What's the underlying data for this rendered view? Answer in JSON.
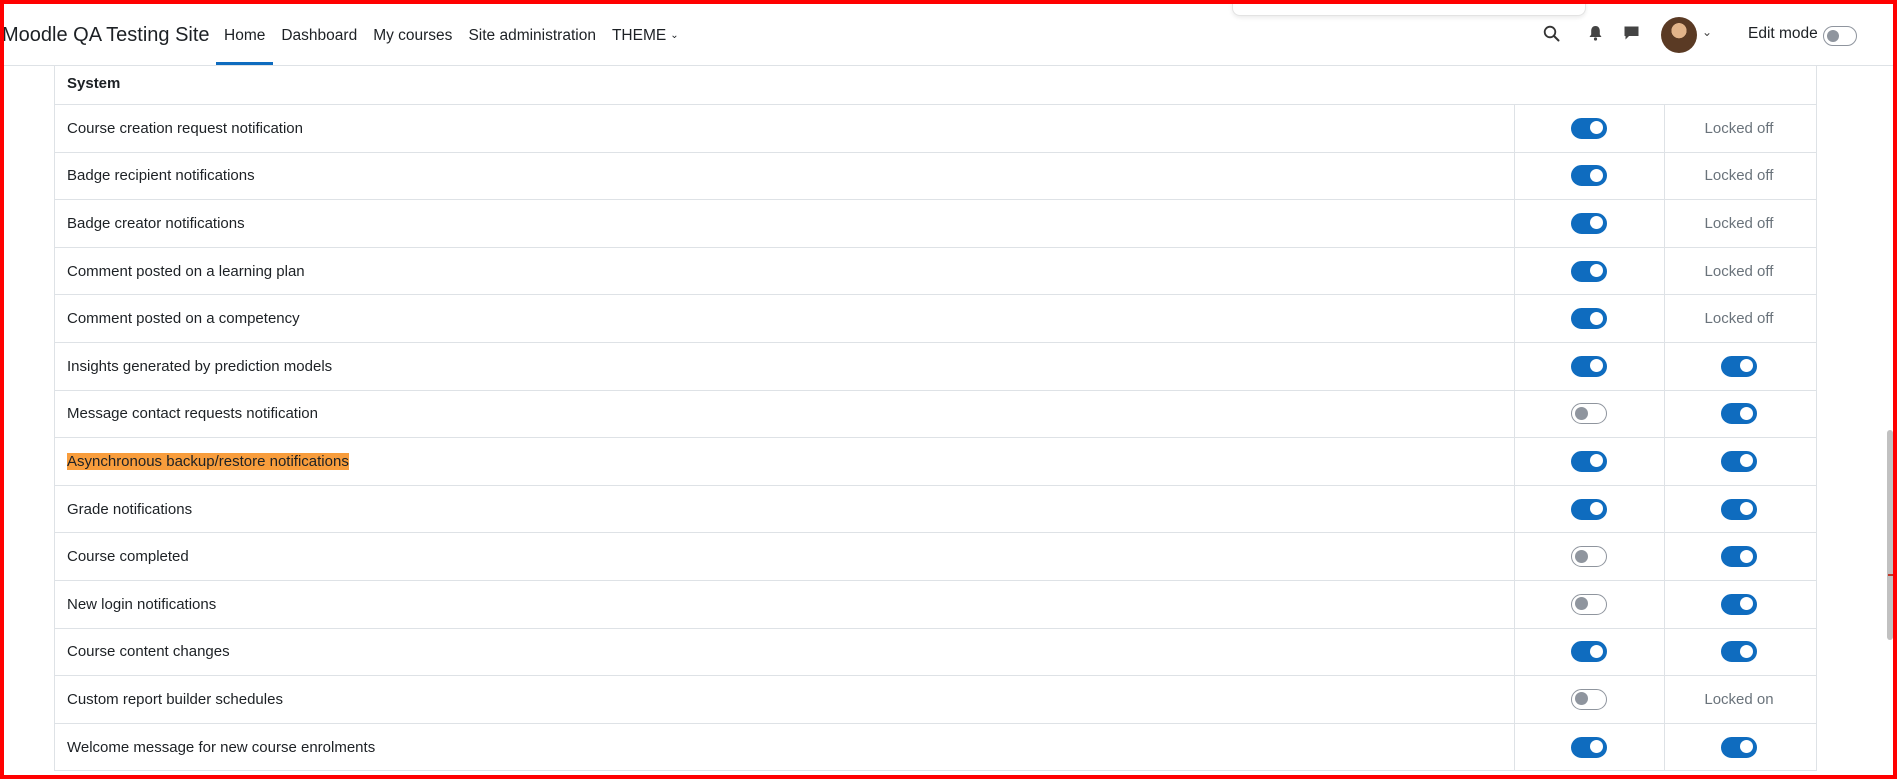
{
  "navbar": {
    "site_name": "Moodle QA Testing Site",
    "items": [
      {
        "label": "Home",
        "active": true
      },
      {
        "label": "Dashboard",
        "active": false
      },
      {
        "label": "My courses",
        "active": false
      },
      {
        "label": "Site administration",
        "active": false
      },
      {
        "label": "THEME",
        "active": false,
        "dropdown": true
      }
    ],
    "icons": [
      "search-icon",
      "bell-icon",
      "chat-icon"
    ],
    "edit_mode_label": "Edit mode",
    "edit_mode_on": false
  },
  "table": {
    "section_header": "System",
    "rows": [
      {
        "name": "Course creation request notification",
        "col_a": "on",
        "col_b": "Locked off"
      },
      {
        "name": "Badge recipient notifications",
        "col_a": "on",
        "col_b": "Locked off"
      },
      {
        "name": "Badge creator notifications",
        "col_a": "on",
        "col_b": "Locked off"
      },
      {
        "name": "Comment posted on a learning plan",
        "col_a": "on",
        "col_b": "Locked off"
      },
      {
        "name": "Comment posted on a competency",
        "col_a": "on",
        "col_b": "Locked off"
      },
      {
        "name": "Insights generated by prediction models",
        "col_a": "on",
        "col_b": "on"
      },
      {
        "name": "Message contact requests notification",
        "col_a": "off",
        "col_b": "on"
      },
      {
        "name": "Asynchronous backup/restore notifications",
        "col_a": "on",
        "col_b": "on",
        "highlighted": true
      },
      {
        "name": "Grade notifications",
        "col_a": "on",
        "col_b": "on"
      },
      {
        "name": "Course completed",
        "col_a": "off",
        "col_b": "on"
      },
      {
        "name": "New login notifications",
        "col_a": "off",
        "col_b": "on"
      },
      {
        "name": "Course content changes",
        "col_a": "on",
        "col_b": "on"
      },
      {
        "name": "Custom report builder schedules",
        "col_a": "off",
        "col_b": "Locked on"
      },
      {
        "name": "Welcome message for new course enrolments",
        "col_a": "on",
        "col_b": "on"
      }
    ]
  },
  "colors": {
    "accent": "#0f6cbf",
    "highlight": "#f89d3c",
    "frame": "#ff0000"
  }
}
